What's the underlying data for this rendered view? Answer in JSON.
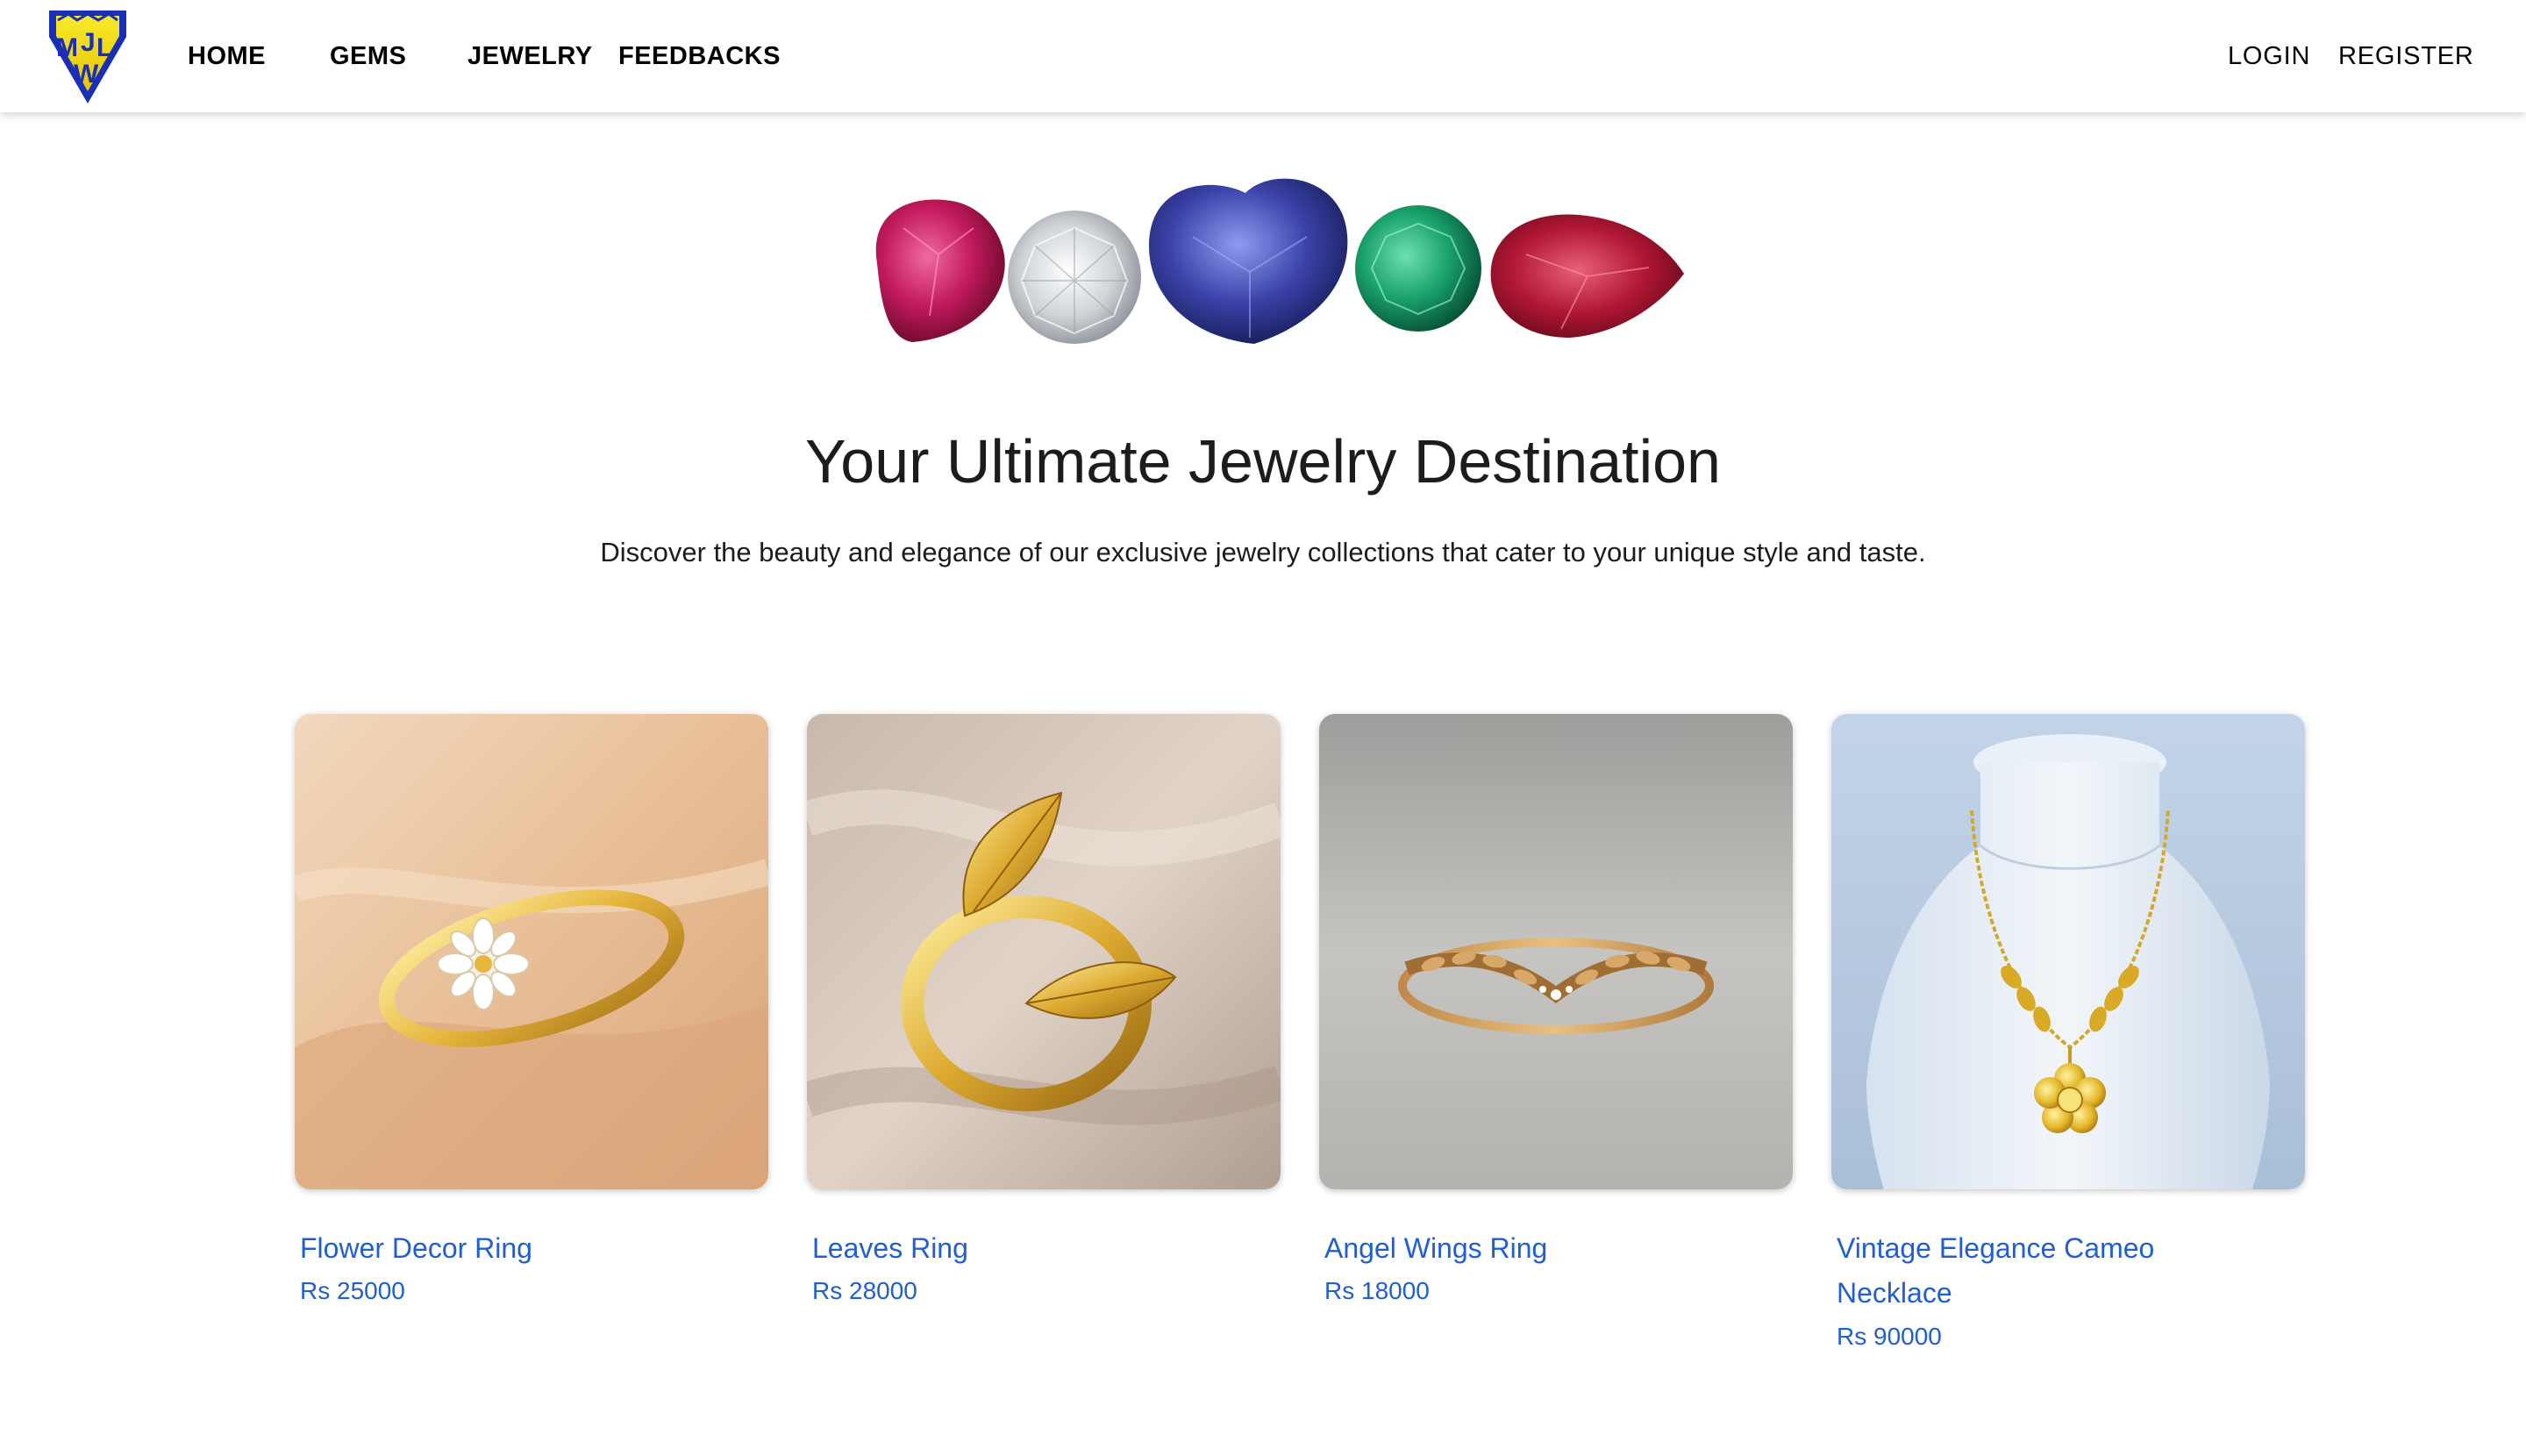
{
  "nav": {
    "logo_text": "MJLW",
    "links": [
      {
        "label": "HOME"
      },
      {
        "label": "GEMS"
      },
      {
        "label": "JEWELRY"
      },
      {
        "label": "FEEDBACKS"
      }
    ],
    "login_label": "LOGIN",
    "register_label": "REGISTER"
  },
  "hero": {
    "title": "Your Ultimate Jewelry Destination",
    "subtitle": "Discover the beauty and elegance of our exclusive jewelry collections that cater to your unique style and taste."
  },
  "products": [
    {
      "name": "Flower Decor Ring",
      "price": "Rs 25000"
    },
    {
      "name": "Leaves Ring",
      "price": "Rs 28000"
    },
    {
      "name": "Angel Wings Ring",
      "price": "Rs 18000"
    },
    {
      "name": "Vintage Elegance Cameo Necklace",
      "price": "Rs 90000"
    }
  ],
  "colors": {
    "link_blue": "#1f5fd1",
    "logo_blue": "#1a2fb8",
    "logo_yellow": "#f4e10a"
  }
}
